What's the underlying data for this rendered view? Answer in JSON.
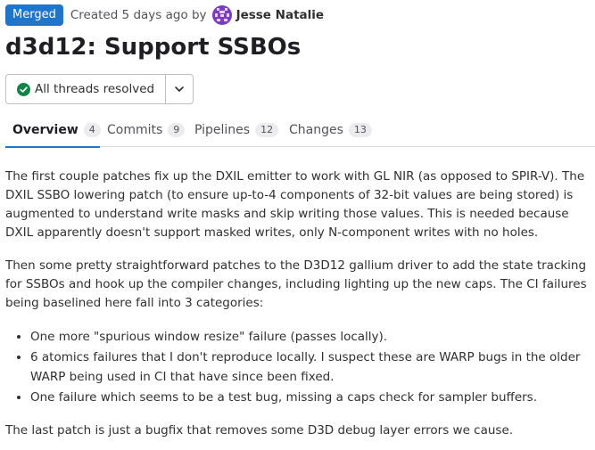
{
  "header": {
    "status": "Merged",
    "created_text": "Created 5 days ago by",
    "author": "Jesse Natalie",
    "colors": {
      "status_badge": "#1f75cb",
      "avatar": "#7a3cc7"
    }
  },
  "title": "d3d12: Support SSBOs",
  "threads": {
    "label": "All threads resolved",
    "icon": "check-circle-icon",
    "dropdown_icon": "chevron-down-icon",
    "color": "#108548"
  },
  "tabs": [
    {
      "label": "Overview",
      "count": "4"
    },
    {
      "label": "Commits",
      "count": "9"
    },
    {
      "label": "Pipelines",
      "count": "12"
    },
    {
      "label": "Changes",
      "count": "13"
    }
  ],
  "description": {
    "p1": "The first couple patches fix up the DXIL emitter to work with GL NIR (as opposed to SPIR-V). The DXIL SSBO lowering patch (to ensure up-to-4 components of 32-bit values are being stored) is augmented to understand write masks and skip writing those values. This is needed because DXIL apparently doesn't support masked writes, only N-component writes with no holes.",
    "p2": "Then some pretty straightforward patches to the D3D12 gallium driver to add the state tracking for SSBOs and hook up the compiler changes, including lighting up the new caps. The CI failures being baselined here fall into 3 categories:",
    "bullets": [
      "One more \"spurious window resize\" failure (passes locally).",
      "6 atomics failures that I don't reproduce locally. I suspect these are WARP bugs in the older WARP being used in CI that have since been fixed.",
      "One failure which seems to be a test bug, missing a caps check for sampler buffers."
    ],
    "p3": "The last patch is just a bugfix that removes some D3D debug layer errors we cause."
  }
}
